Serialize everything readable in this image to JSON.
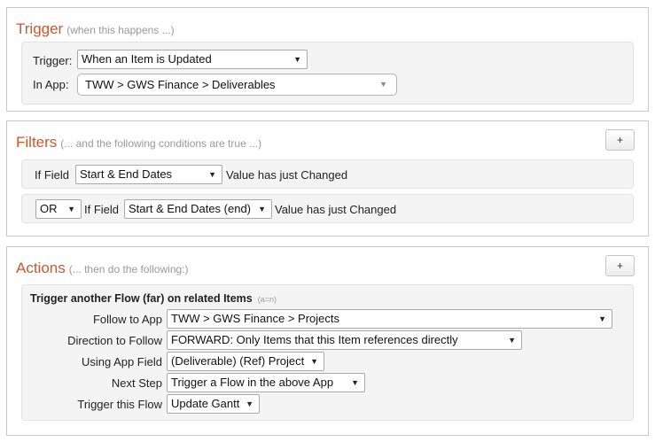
{
  "trigger": {
    "title": "Trigger",
    "subtitle": "(when this happens ...)",
    "trigger_label": "Trigger:",
    "trigger_value": "When an Item is Updated",
    "app_label": "In App:",
    "app_value": "TWW > GWS Finance > Deliverables"
  },
  "filters": {
    "title": "Filters",
    "subtitle": "(... and the following conditions are true ...)",
    "add_label": "+",
    "rows": [
      {
        "if_label": "If Field",
        "field": "Start & End Dates",
        "condition": "Value has just Changed"
      },
      {
        "op": "OR",
        "if_label": "If Field",
        "field": "Start & End Dates (end)",
        "condition": "Value has just Changed"
      }
    ]
  },
  "actions": {
    "title": "Actions",
    "subtitle": "(... then do the following:)",
    "add_label": "+",
    "action_title": "Trigger another Flow (far) on related Items",
    "action_note": "(a=n)",
    "fields": [
      {
        "label": "Follow to App",
        "value": "TWW > GWS Finance > Projects"
      },
      {
        "label": "Direction to Follow",
        "value": "FORWARD: Only Items that this Item references directly"
      },
      {
        "label": "Using App Field",
        "value": "(Deliverable) (Ref) Project"
      },
      {
        "label": "Next Step",
        "value": "Trigger a Flow in the above App"
      },
      {
        "label": "Trigger this Flow",
        "value": "Update Gantt"
      }
    ]
  },
  "icons": {
    "dropdown_arrow": "▼"
  }
}
